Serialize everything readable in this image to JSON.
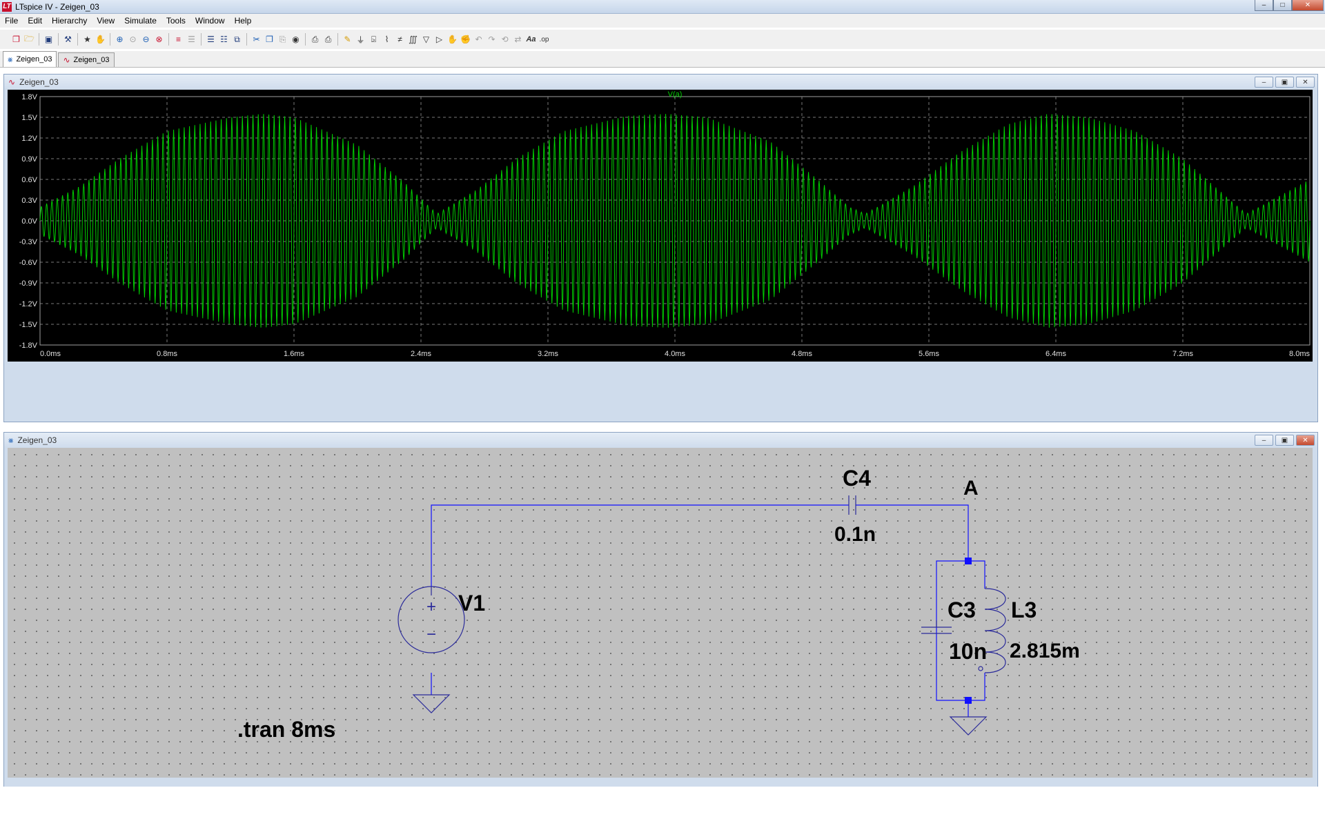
{
  "window": {
    "title": "LTspice IV - Zeigen_03"
  },
  "menu": [
    "File",
    "Edit",
    "Hierarchy",
    "View",
    "Simulate",
    "Tools",
    "Window",
    "Help"
  ],
  "toolbar": {
    "icons": [
      "new-schematic-icon",
      "open-icon",
      "save-icon",
      "control-panel-icon",
      "run-icon",
      "halt-icon",
      "zoom-in-icon",
      "zoom-pan-icon",
      "zoom-out-icon",
      "zoom-fit-icon",
      "autorange-icon",
      "mark-icon",
      "tile-horizontal-icon",
      "tile-vertical-icon",
      "cascade-icon",
      "cut-icon",
      "copy-icon",
      "paste-icon",
      "find-icon",
      "print-setup-icon",
      "print-icon",
      "draw-wire-icon",
      "ground-icon",
      "label-net-icon",
      "resistor-icon",
      "capacitor-icon",
      "inductor-icon",
      "diode-icon",
      "component-icon",
      "move-icon",
      "drag-icon",
      "undo-icon",
      "redo-icon",
      "rotate-icon",
      "mirror-icon",
      "text-icon",
      "spice-directive-icon"
    ],
    "text_icon": "Aa",
    "directive_icon": ".op"
  },
  "tabs": [
    {
      "label": "Zeigen_03",
      "kind": "schematic",
      "active": true
    },
    {
      "label": "Zeigen_03",
      "kind": "waveform",
      "active": false
    }
  ],
  "waveform_window": {
    "title": "Zeigen_03",
    "trace_label": "V(a)",
    "trace_color": "#00d000",
    "y_ticks": [
      "1.8V",
      "1.5V",
      "1.2V",
      "0.9V",
      "0.6V",
      "0.3V",
      "0.0V",
      "-0.3V",
      "-0.6V",
      "-0.9V",
      "-1.2V",
      "-1.5V",
      "-1.8V"
    ],
    "x_ticks": [
      "0.0ms",
      "0.8ms",
      "1.6ms",
      "2.4ms",
      "3.2ms",
      "4.0ms",
      "4.8ms",
      "5.6ms",
      "6.4ms",
      "7.2ms",
      "8.0ms"
    ]
  },
  "chart_data": {
    "type": "line",
    "title": "",
    "xlabel": "",
    "ylabel": "",
    "xlim": [
      0,
      8
    ],
    "ylim": [
      -1.8,
      1.8
    ],
    "grid": true,
    "series": [
      {
        "name": "V(a)",
        "carrier_cycles": 240,
        "envelope": {
          "x": [
            0.0,
            0.25,
            0.5,
            0.8,
            1.2,
            1.4,
            1.6,
            2.0,
            2.3,
            2.5,
            2.75,
            3.0,
            3.3,
            3.7,
            3.95,
            4.2,
            4.6,
            4.9,
            5.1,
            5.2,
            5.5,
            5.8,
            6.1,
            6.35,
            6.6,
            6.9,
            7.2,
            7.5,
            7.6,
            7.8,
            8.0
          ],
          "y": [
            0.2,
            0.5,
            0.9,
            1.3,
            1.5,
            1.55,
            1.5,
            1.1,
            0.55,
            0.1,
            0.45,
            0.9,
            1.3,
            1.52,
            1.55,
            1.5,
            1.15,
            0.6,
            0.2,
            0.1,
            0.5,
            1.0,
            1.4,
            1.55,
            1.5,
            1.3,
            0.9,
            0.3,
            0.1,
            0.35,
            0.6
          ]
        }
      }
    ]
  },
  "schematic_window": {
    "title": "Zeigen_03",
    "components": {
      "v1": {
        "name": "V1",
        "plus": "+",
        "minus": "−"
      },
      "c4": {
        "name": "C4",
        "value": "0.1n"
      },
      "c3": {
        "name": "C3",
        "value": "10n"
      },
      "l3": {
        "name": "L3",
        "value": "2.815m"
      }
    },
    "net_label": "A",
    "directive": ".tran 8ms",
    "wire_color": "#1010ff"
  }
}
